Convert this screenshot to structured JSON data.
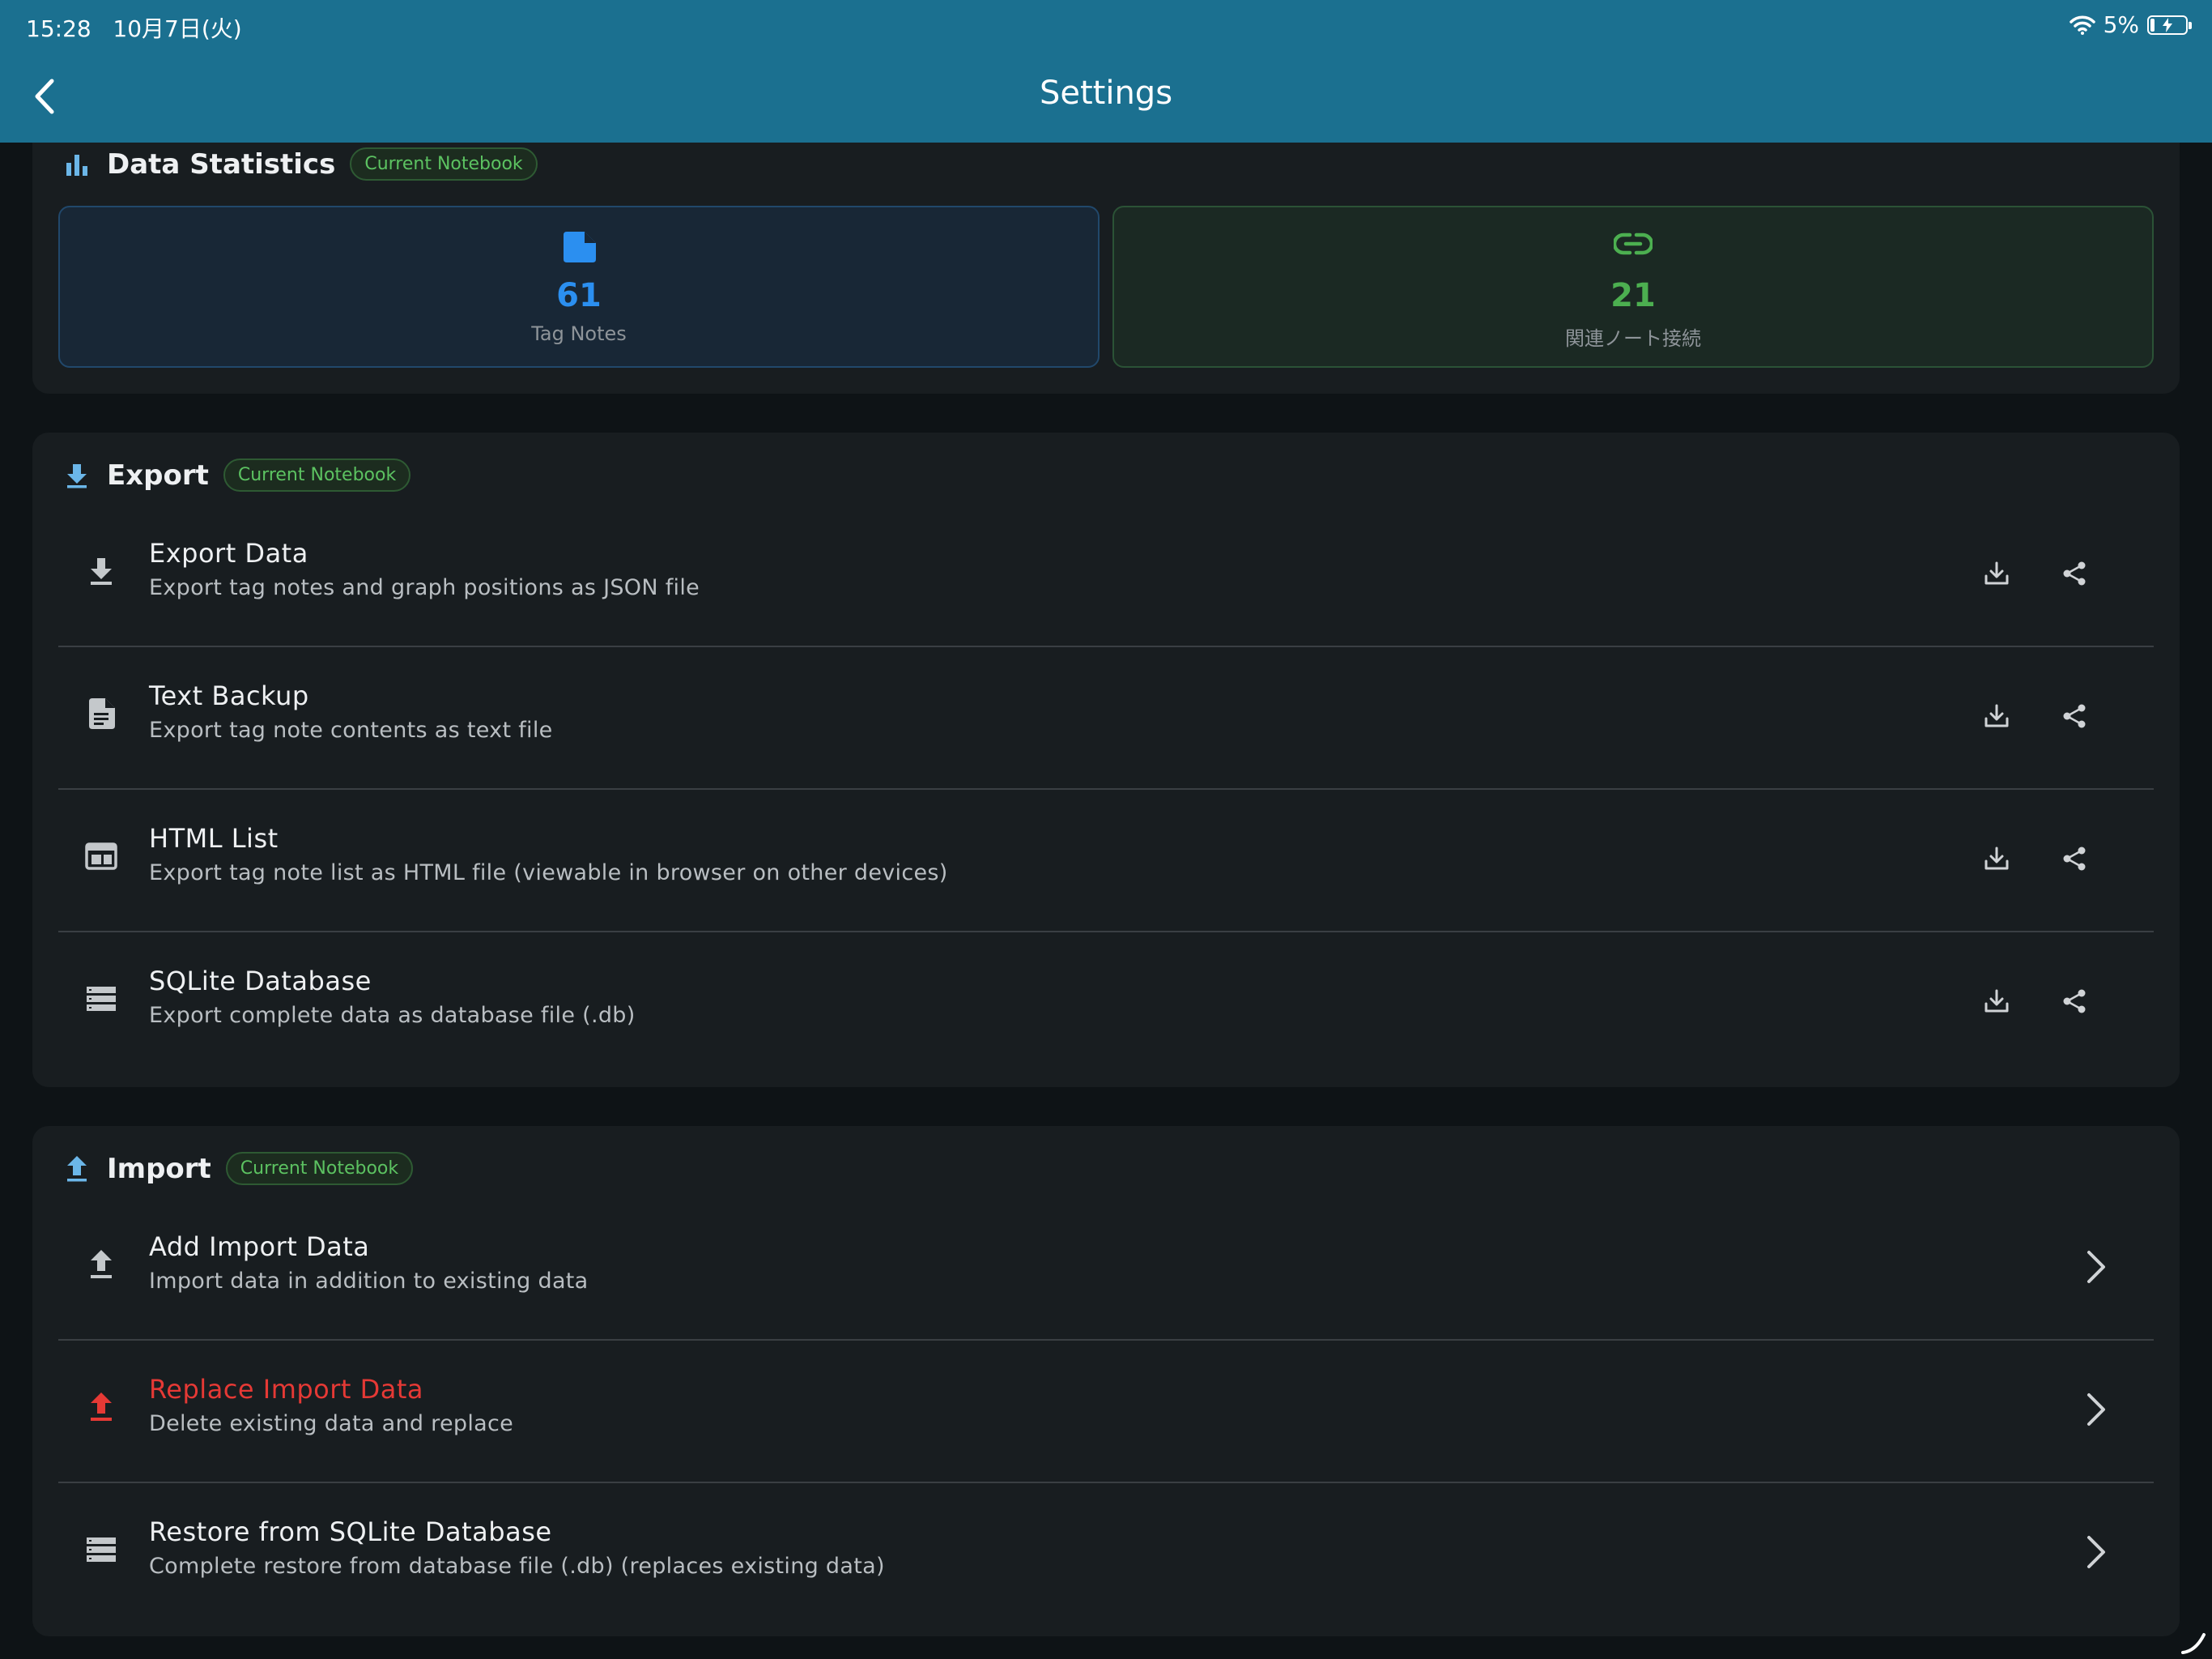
{
  "status_bar": {
    "time": "15:28",
    "date": "10月7日(火)",
    "battery": "5%"
  },
  "header": {
    "title": "Settings"
  },
  "stats": {
    "title": "Data Statistics",
    "badge": "Current Notebook",
    "items": [
      {
        "value": "61",
        "label": "Tag Notes",
        "icon": "document-icon",
        "color": "#2b8ff0"
      },
      {
        "value": "21",
        "label": "関連ノート接続",
        "icon": "link-icon",
        "color": "#4caf50"
      }
    ]
  },
  "export": {
    "title": "Export",
    "badge": "Current Notebook",
    "items": [
      {
        "title": "Export Data",
        "subtitle": "Export tag notes and graph positions as JSON file",
        "icon": "download-icon"
      },
      {
        "title": "Text Backup",
        "subtitle": "Export tag note contents as text file",
        "icon": "text-file-icon"
      },
      {
        "title": "HTML List",
        "subtitle": "Export tag note list as HTML file (viewable in browser on other devices)",
        "icon": "web-window-icon"
      },
      {
        "title": "SQLite Database",
        "subtitle": "Export complete data as database file (.db)",
        "icon": "database-icon"
      }
    ]
  },
  "import": {
    "title": "Import",
    "badge": "Current Notebook",
    "items": [
      {
        "title": "Add Import Data",
        "subtitle": "Import data in addition to existing data",
        "icon": "upload-icon"
      },
      {
        "title": "Replace Import Data",
        "subtitle": "Delete existing data and replace",
        "icon": "upload-icon",
        "color": "#e53935"
      },
      {
        "title": "Restore from SQLite Database",
        "subtitle": "Complete restore from database file (.db) (replaces existing data)",
        "icon": "database-icon"
      }
    ]
  }
}
